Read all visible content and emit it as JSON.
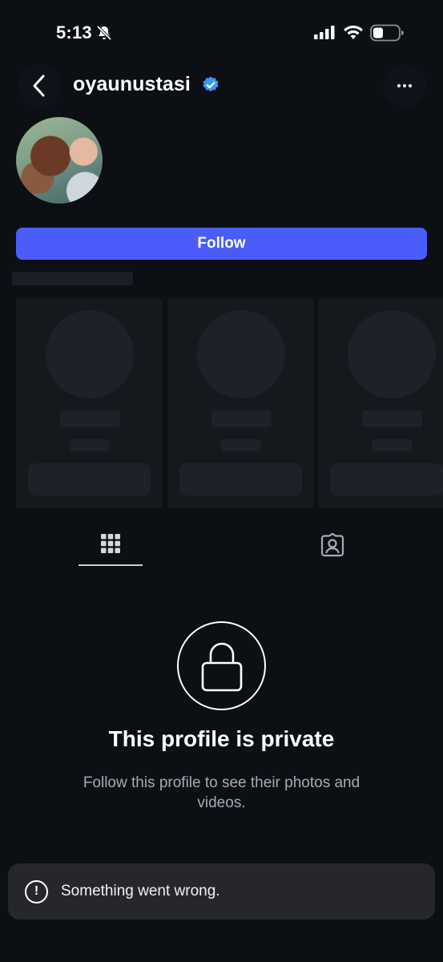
{
  "status_bar": {
    "time": "5:13",
    "icons": [
      "bell-slash-icon",
      "cellular-signal-icon",
      "wifi-icon",
      "battery-icon"
    ]
  },
  "header": {
    "username": "oyaunustasi",
    "verified": true,
    "back_icon": "chevron-left-icon",
    "more_icon": "more-horizontal-icon"
  },
  "profile": {
    "follow_label": "Follow"
  },
  "tabs": [
    {
      "icon": "grid-icon",
      "active": true
    },
    {
      "icon": "tagged-person-icon",
      "active": false
    }
  ],
  "private": {
    "icon": "lock-icon",
    "title": "This profile is private",
    "description": "Follow this profile to see their photos and videos."
  },
  "toast": {
    "icon": "alert-circle-icon",
    "message": "Something went wrong."
  },
  "colors": {
    "background": "#0c0f14",
    "accent": "#4a5dfb",
    "verified_badge": "#3897f0",
    "muted_text": "#a8abb2",
    "toast_bg": "#25272b"
  }
}
